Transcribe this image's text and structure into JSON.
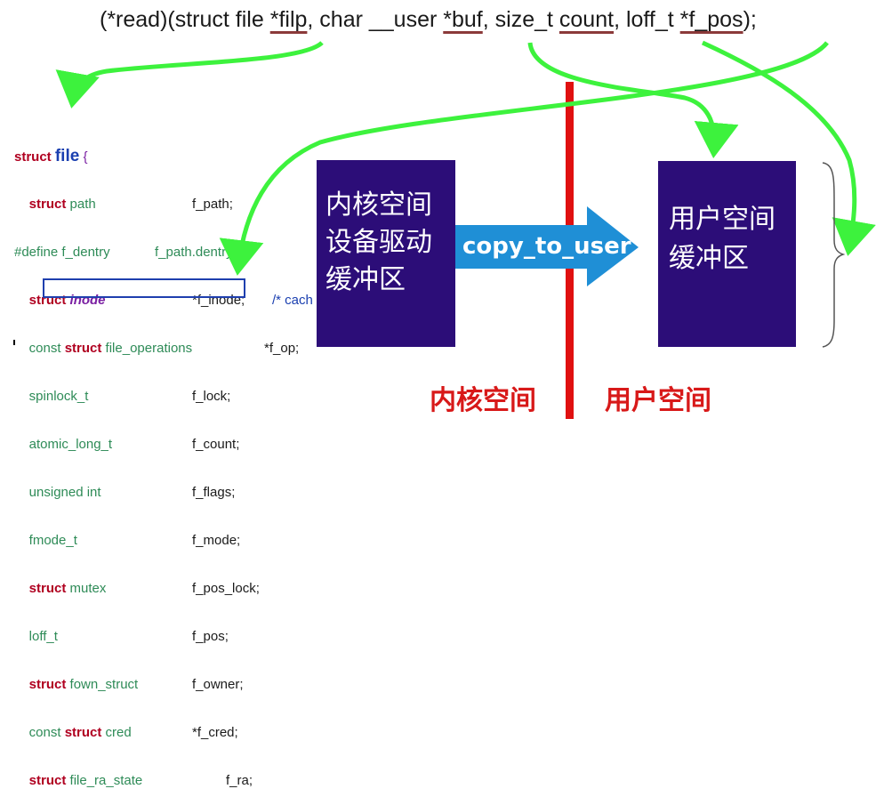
{
  "signature": {
    "prefix": "(*read)(struct file ",
    "filp": "*filp",
    "sep1": ", char __user ",
    "buf": "*buf",
    "sep2": ", size_t ",
    "count": "count",
    "sep3": ", loff_t ",
    "fpos": "*f_pos",
    "suffix": ");"
  },
  "struct_code": {
    "header_kw": "struct",
    "header_name": "file",
    "header_brace": "{",
    "rows": [
      {
        "kw": "struct",
        "type": " path",
        "member": "f_path;"
      },
      {
        "define": "#define f_dentry",
        "member": "f_path.dentry"
      },
      {
        "kw": "struct",
        "type": " inode",
        "member": "*f_inode;",
        "comment": "/* cach"
      },
      {
        "type_pre": "const ",
        "kw": "struct",
        "type": " file_operations",
        "member": "*f_op;"
      },
      {
        "type": "spinlock_t",
        "member": "f_lock;"
      },
      {
        "type": "atomic_long_t",
        "member": "f_count;"
      },
      {
        "type": "unsigned int",
        "member": "f_flags;"
      },
      {
        "type": "fmode_t",
        "member": "f_mode;"
      },
      {
        "kw": "struct",
        "type": " mutex",
        "member": "f_pos_lock;"
      },
      {
        "type": "loff_t",
        "member": "f_pos;"
      },
      {
        "kw": "struct",
        "type": " fown_struct",
        "member": "f_owner;"
      },
      {
        "type_pre": "const ",
        "kw": "struct",
        "type": " cred",
        "member": "*f_cred;"
      },
      {
        "kw": "struct",
        "type": " file_ra_state",
        "member": "f_ra;"
      }
    ]
  },
  "kernel_box": {
    "line1": "内核空间",
    "line2": "设备驱动",
    "line3": "缓冲区"
  },
  "user_box": {
    "line1": "用户空间",
    "line2": "缓冲区"
  },
  "copy_arrow": {
    "label": "copy_to_user"
  },
  "bottom_labels": {
    "kernel": "内核空间",
    "user": "用户空间"
  },
  "colors": {
    "box": "#2c0d78",
    "arrow_blue": "#1f8fd6",
    "divider_red": "#e01010",
    "green_arrow": "#3df23d",
    "label_red": "#d81919"
  }
}
